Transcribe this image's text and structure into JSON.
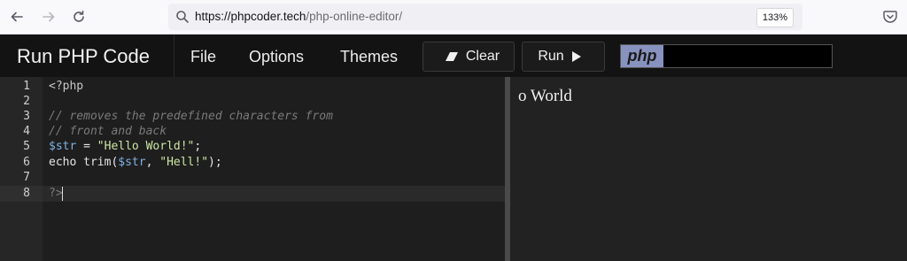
{
  "browser": {
    "url_domain": "https://phpcoder.tech",
    "url_path": "/php-online-editor/",
    "zoom": "133%"
  },
  "app": {
    "title": "Run PHP Code",
    "menu": [
      "File",
      "Options",
      "Themes"
    ],
    "clear_label": "Clear",
    "run_label": "Run",
    "language_logo": "php"
  },
  "editor": {
    "line_numbers": [
      "1",
      "2",
      "3",
      "4",
      "5",
      "6",
      "7",
      "8"
    ],
    "lines": [
      "<?php",
      "",
      "// removes the predefined characters from",
      "// front and back",
      "$str = \"Hello World!\";",
      "echo trim($str, \"Hell!\");",
      "",
      "?>"
    ],
    "active_line": 8
  },
  "output": {
    "text": "o World"
  },
  "colors": {
    "comment": "#7a7a7a",
    "variable": "#7fb2e5",
    "string": "#cce6a4",
    "php_badge": "#8892bf"
  }
}
